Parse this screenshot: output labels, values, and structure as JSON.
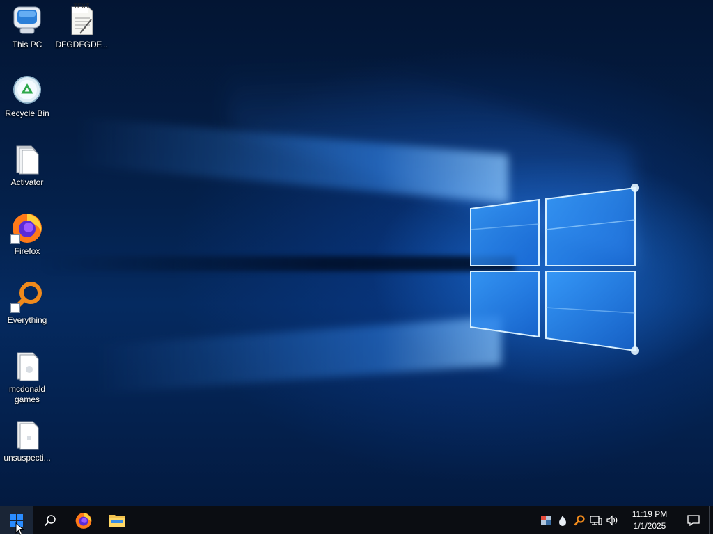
{
  "desktop": {
    "icons": [
      {
        "label": "This PC",
        "icon": "this-pc-icon"
      },
      {
        "label": "DFGDFGDF...",
        "icon": "text-file-icon",
        "badge": "TEXT"
      },
      {
        "label": "Recycle Bin",
        "icon": "recycle-bin-icon"
      },
      {
        "label": "Activator",
        "icon": "folder-icon"
      },
      {
        "label": "Firefox",
        "icon": "firefox-icon"
      },
      {
        "label": "Everything",
        "icon": "everything-search-icon"
      },
      {
        "label": "mcdonald games",
        "icon": "folder-icon"
      },
      {
        "label": "unsuspecti...",
        "icon": "folder-icon"
      }
    ]
  },
  "taskbar": {
    "start_icon": "windows-logo-icon",
    "search_icon": "search-icon",
    "pinned": [
      {
        "name": "Firefox",
        "icon": "firefox-icon"
      },
      {
        "name": "File Explorer",
        "icon": "file-explorer-icon"
      }
    ],
    "tray_icons": [
      "defender-icon",
      "water-drop-icon",
      "everything-search-icon",
      "network-icon",
      "volume-icon"
    ],
    "clock": {
      "time": "11:19 PM",
      "date": "1/1/2025"
    },
    "notification_icon": "notification-icon"
  },
  "colors": {
    "wallpaper_deep": "#031533",
    "wallpaper_glow": "#2a8cff",
    "taskbar": "#0b0d12",
    "start_button": "#1a2536",
    "firefox_orange": "#ff7a18",
    "everything_orange": "#f08a1c",
    "windows_blue": "#2a8cff"
  }
}
